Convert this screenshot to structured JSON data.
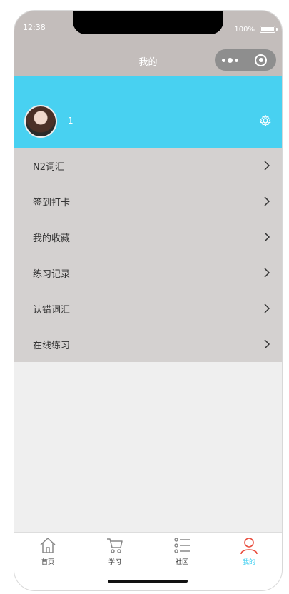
{
  "status_bar": {
    "time": "12:38",
    "battery": "100%"
  },
  "nav": {
    "title": "我的"
  },
  "profile": {
    "username": "1"
  },
  "menu": {
    "items": [
      {
        "label": "N2词汇"
      },
      {
        "label": "签到打卡"
      },
      {
        "label": "我的收藏"
      },
      {
        "label": "练习记录"
      },
      {
        "label": "认错词汇"
      },
      {
        "label": "在线练习"
      }
    ]
  },
  "tabbar": {
    "items": [
      {
        "label": "首页",
        "icon": "home-icon"
      },
      {
        "label": "学习",
        "icon": "cart-icon"
      },
      {
        "label": "社区",
        "icon": "list-icon"
      },
      {
        "label": "我的",
        "icon": "person-icon",
        "active": true
      }
    ],
    "active_color": "#48d1f1"
  },
  "colors": {
    "header": "#c3bdbb",
    "profile_bg": "#48d1f1",
    "menu_bg": "#d4d1d0",
    "page_bg": "#efefef"
  }
}
